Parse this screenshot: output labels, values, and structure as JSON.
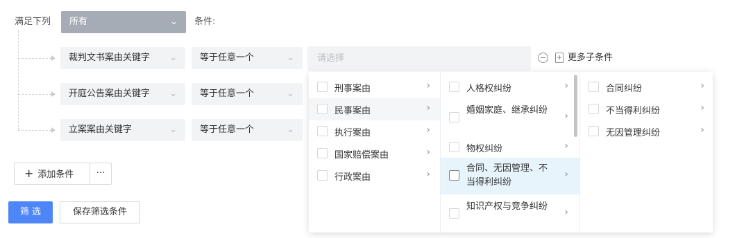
{
  "header": {
    "satisfy_label": "满足下列",
    "scope_value": "所有",
    "condition_label": "条件:"
  },
  "rows": [
    {
      "field": "裁判文书案由关键字",
      "operator": "等于任意一个"
    },
    {
      "field": "开庭公告案由关键字",
      "operator": "等于任意一个"
    },
    {
      "field": "立案案由关键字",
      "operator": "等于任意一个"
    }
  ],
  "cascader": {
    "placeholder": "请选择",
    "more_conditions_label": "更多子条件"
  },
  "menu": {
    "level1": [
      "刑事案由",
      "民事案由",
      "执行案由",
      "国家赔偿案由",
      "行政案由"
    ],
    "level2": [
      "人格权纠纷",
      "婚姻家庭、继承纠纷",
      "物权纠纷",
      "合同、无因管理、不当得利纠纷",
      "知识产权与竞争纠纷"
    ],
    "level3": [
      "合同纠纷",
      "不当得利纠纷",
      "无因管理纠纷"
    ]
  },
  "footer": {
    "add_condition_label": "添加条件",
    "more_label": "···",
    "filter_label": "筛 选",
    "save_filter_label": "保存筛选条件"
  },
  "icons": {
    "chevron_down": "chevron-down-icon",
    "chevron_right": "chevron-right-icon",
    "plus": "plus-icon",
    "minus_circle": "minus-circle-icon",
    "add_document": "add-document-icon"
  },
  "colors": {
    "primary": "#4f86f7",
    "scope_select_bg": "#a6acb6",
    "active_row_bg": "#e8f4fb"
  }
}
